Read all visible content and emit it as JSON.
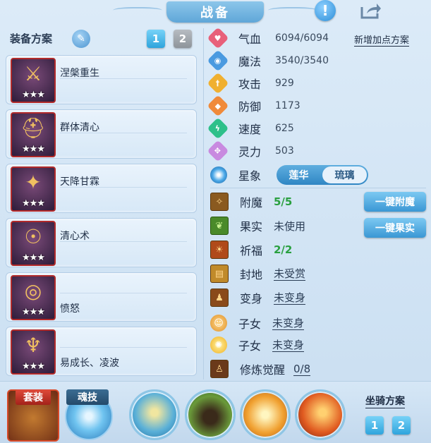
{
  "header": {
    "title": "战备",
    "help_label": "!",
    "share_icon": "share-icon"
  },
  "equip_scheme": {
    "label": "装备方案",
    "edit_icon": "pen-icon",
    "tabs": [
      "1",
      "2"
    ],
    "active_tab": "1"
  },
  "equipment": [
    {
      "name": "涅槃重生",
      "stars": "★★★",
      "icon": "weapon-icon"
    },
    {
      "name": "群体清心",
      "stars": "★★★",
      "icon": "helmet-icon"
    },
    {
      "name": "天降甘霖",
      "stars": "★★★",
      "icon": "armor-icon"
    },
    {
      "name": "清心术",
      "stars": "★★★",
      "icon": "necklace-icon"
    },
    {
      "name": "愤怒",
      "stars": "★★★",
      "icon": "belt-icon"
    },
    {
      "name": "易成长、凌波",
      "stars": "★★★",
      "icon": "boots-icon"
    }
  ],
  "stats": [
    {
      "name": "气血",
      "value": "6094/6094",
      "color": "#e8607a",
      "icon": "heart-icon"
    },
    {
      "name": "魔法",
      "value": "3540/3540",
      "color": "#4a9ae0",
      "icon": "mana-icon"
    },
    {
      "name": "攻击",
      "value": "929",
      "color": "#f0b030",
      "icon": "attack-icon"
    },
    {
      "name": "防御",
      "value": "1173",
      "color": "#f08a3a",
      "icon": "defense-icon"
    },
    {
      "name": "速度",
      "value": "625",
      "color": "#2ec08a",
      "icon": "speed-icon"
    },
    {
      "name": "灵力",
      "value": "503",
      "color": "#c88ae0",
      "icon": "spirit-icon"
    }
  ],
  "add_point_label": "新增加点方案",
  "star_sign": {
    "name": "星象",
    "options": [
      "莲华",
      "琉璃"
    ],
    "selected": "琉璃"
  },
  "properties": [
    {
      "name": "附魔",
      "value": "5/5",
      "style": "green",
      "icon": "enchant-icon"
    },
    {
      "name": "果实",
      "value": "未使用",
      "style": "plain",
      "icon": "fruit-icon"
    },
    {
      "name": "祈福",
      "value": "2/2",
      "style": "green",
      "icon": "bless-icon"
    },
    {
      "name": "封地",
      "value": "未受赏",
      "style": "ul",
      "icon": "fief-icon"
    },
    {
      "name": "变身",
      "value": "未变身",
      "style": "ul",
      "icon": "transform-icon"
    },
    {
      "name": "子女",
      "value": "未变身",
      "style": "ul",
      "icon": "child-icon"
    },
    {
      "name": "子女",
      "value": "未变身",
      "style": "ul",
      "icon": "child2-icon"
    },
    {
      "name": "修炼觉醒",
      "value": "0/8",
      "style": "ul",
      "icon": "awaken-icon"
    }
  ],
  "actions": {
    "one_key_enchant": "一键附魔",
    "one_key_fruit": "一键果实"
  },
  "bottom": {
    "set_label": "套装",
    "soul_label": "魂技",
    "skills": [
      "skill-1-icon",
      "skill-2-icon",
      "skill-3-icon",
      "skill-4-icon"
    ],
    "mount_label": "坐骑方案",
    "mount_tabs": [
      "1",
      "2"
    ]
  }
}
